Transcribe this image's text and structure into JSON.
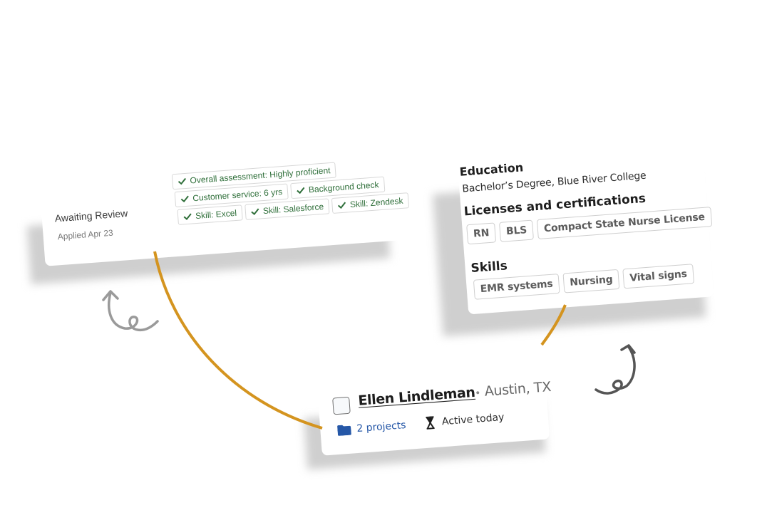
{
  "application_card": {
    "status": "Awaiting Review",
    "applied": "Applied Apr 23",
    "badges": [
      [
        "Overall assessment: Highly proficient"
      ],
      [
        "Customer service: 6 yrs",
        "Background check"
      ],
      [
        "Skill: Excel",
        "Skill: Salesforce",
        "Skill: Zendesk"
      ]
    ],
    "badge_icon": "checkmark-icon",
    "badge_color": "#2f6f3a"
  },
  "credentials_card": {
    "education_heading": "Education",
    "education_value": "Bachelor’s Degree, Blue River College",
    "licenses_heading": "Licenses and certifications",
    "licenses": [
      "RN",
      "BLS",
      "Compact State Nurse License"
    ],
    "skills_heading": "Skills",
    "skills": [
      "EMR systems",
      "Nursing",
      "Vital signs"
    ]
  },
  "candidate_card": {
    "name": "Ellen Lindleman",
    "separator": "•",
    "location": "Austin, TX",
    "projects": "2 projects",
    "projects_icon": "folder-icon",
    "activity": "Active today",
    "activity_icon": "hourglass-icon",
    "link_color": "#2557a7"
  },
  "decor": {
    "connector_color": "#d4941f",
    "arrow_color_left": "#9a9a9a",
    "arrow_color_right": "#555555"
  }
}
